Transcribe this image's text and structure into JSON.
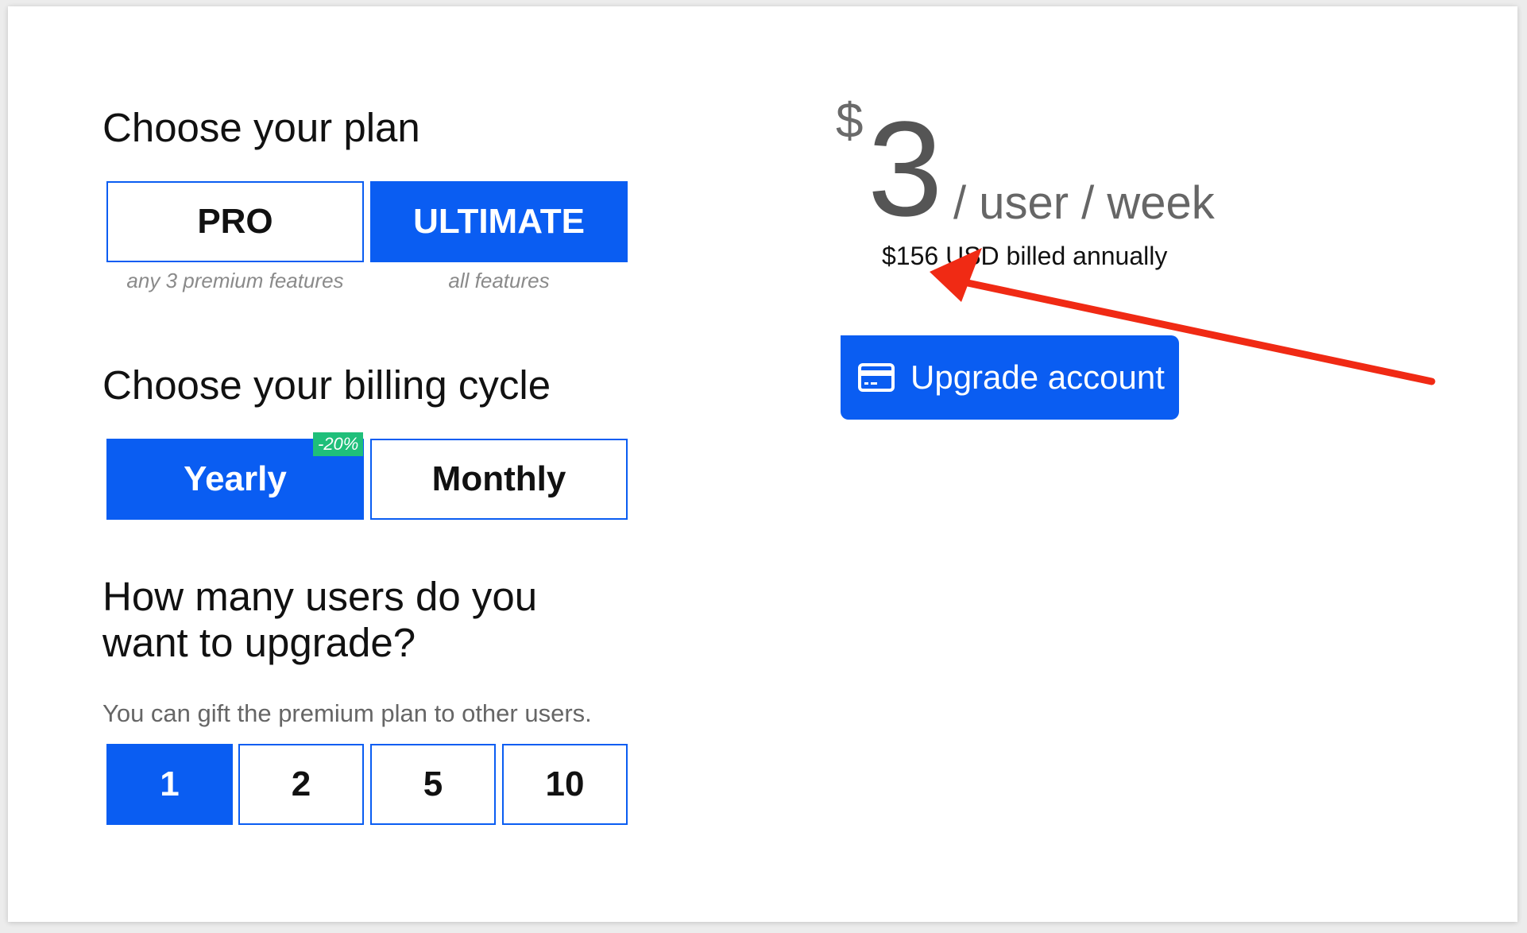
{
  "plan": {
    "title": "Choose your plan",
    "options": [
      {
        "label": "PRO",
        "caption": "any 3 premium features",
        "selected": false
      },
      {
        "label": "ULTIMATE",
        "caption": "all features",
        "selected": true
      }
    ]
  },
  "billing": {
    "title": "Choose your billing cycle",
    "options": [
      {
        "label": "Yearly",
        "badge": "-20%",
        "selected": true
      },
      {
        "label": "Monthly",
        "selected": false
      }
    ]
  },
  "users": {
    "title_line1": "How many users do you",
    "title_line2": "want to upgrade?",
    "subtitle": "You can gift the premium plan to other users.",
    "options": [
      {
        "label": "1",
        "selected": true
      },
      {
        "label": "2",
        "selected": false
      },
      {
        "label": "5",
        "selected": false
      },
      {
        "label": "10",
        "selected": false
      }
    ]
  },
  "price": {
    "currency": "$",
    "amount": "3",
    "unit": "/ user / week",
    "billed": "$156 USD billed annually"
  },
  "upgrade_button": {
    "label": "Upgrade account",
    "icon": "credit-card-icon"
  },
  "annotation": {
    "arrow_color": "#f02a14"
  },
  "colors": {
    "accent": "#0a5df2",
    "badge": "#1fbf7a",
    "background": "#ffffff"
  }
}
